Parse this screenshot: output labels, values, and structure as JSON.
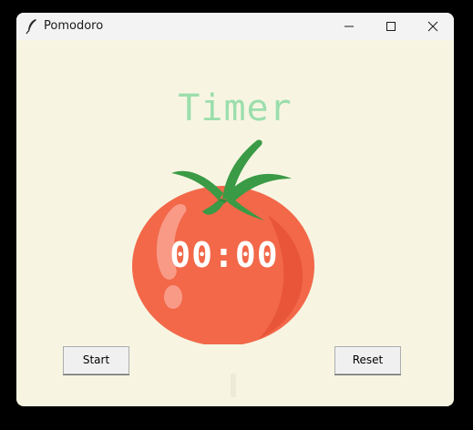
{
  "window": {
    "title": "Pomodoro",
    "app_icon": "feather-icon",
    "controls": {
      "minimize": "minimize-icon",
      "maximize": "maximize-icon",
      "close": "close-icon"
    }
  },
  "main": {
    "title": "Timer",
    "countdown": "00:00",
    "checkmarks": "",
    "image": "tomato"
  },
  "buttons": {
    "start_label": "Start",
    "reset_label": "Reset"
  },
  "colors": {
    "background": "#f7f5e2",
    "title_green": "#9bdeac",
    "tomato_red": "#f26849",
    "leaf_green": "#3a9a45"
  }
}
